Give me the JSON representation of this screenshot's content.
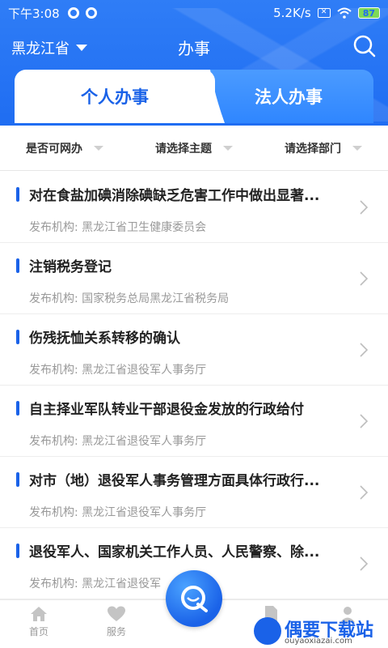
{
  "status_bar": {
    "time": "下午3:08",
    "network_speed": "5.2K/s",
    "battery": "87"
  },
  "header": {
    "province": "黑龙江省",
    "title": "办事"
  },
  "tabs": [
    {
      "label": "个人办事",
      "active": true
    },
    {
      "label": "法人办事",
      "active": false
    }
  ],
  "filters": [
    {
      "label": "是否可网办"
    },
    {
      "label": "请选择主题"
    },
    {
      "label": "请选择部门"
    }
  ],
  "list": {
    "items": [
      {
        "title": "对在食盐加碘消除碘缺乏危害工作中做出显著...",
        "org": "发布机构: 黑龙江省卫生健康委员会"
      },
      {
        "title": "注销税务登记",
        "org": "发布机构: 国家税务总局黑龙江省税务局"
      },
      {
        "title": "伤残抚恤关系转移的确认",
        "org": "发布机构: 黑龙江省退役军人事务厅"
      },
      {
        "title": "自主择业军队转业干部退役金发放的行政给付",
        "org": "发布机构: 黑龙江省退役军人事务厅"
      },
      {
        "title": "对市（地）退役军人事务管理方面具体行政行...",
        "org": "发布机构: 黑龙江省退役军人事务厅"
      },
      {
        "title": "退役军人、国家机关工作人员、人民警察、除...",
        "org": "发布机构: 黑龙江省退役军"
      }
    ]
  },
  "bottom_nav": {
    "items": [
      {
        "label": "首页"
      },
      {
        "label": "服务"
      }
    ]
  },
  "watermark": {
    "title": "偶要下载站",
    "url": "ouyaoxiazai.com"
  },
  "colors": {
    "primary": "#1f6df2",
    "accent": "#1a62e8",
    "battery": "#7ed957"
  }
}
